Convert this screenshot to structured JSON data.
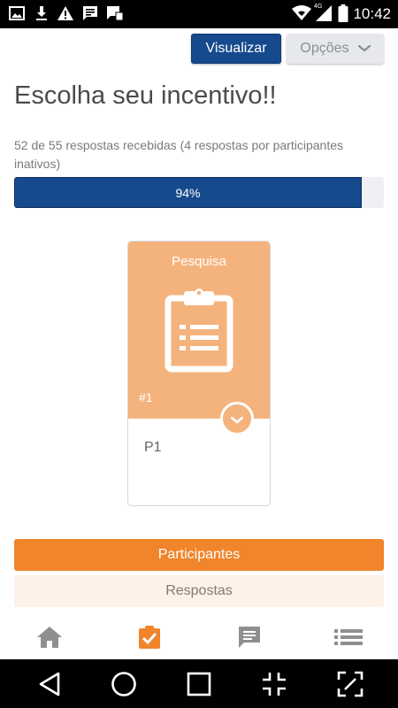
{
  "status_bar": {
    "time": "10:42",
    "network_label": "4G",
    "icons": [
      "image-icon",
      "download-icon",
      "warning-icon",
      "message-icon",
      "sms-icon",
      "wifi-icon",
      "signal-icon",
      "battery-icon"
    ]
  },
  "toolbar": {
    "view_label": "Visualizar",
    "options_label": "Opções"
  },
  "page": {
    "title": "Escolha seu incentivo!!",
    "responses_text": "52 de 55 respostas recebidas (4 respostas por participantes inativos)",
    "progress_label": "94%",
    "progress_value": 0.94
  },
  "card": {
    "type_label": "Pesquisa",
    "number": "#1",
    "name": "P1",
    "icon": "clipboard-list-icon"
  },
  "tabs": {
    "participants_label": "Participantes",
    "responses_label": "Respostas"
  },
  "bottom_nav": {
    "items": [
      "home-icon",
      "tasks-icon",
      "chat-icon",
      "list-icon"
    ],
    "active": "tasks-icon"
  },
  "colors": {
    "primary_blue": "#164a8d",
    "accent_orange": "#f0852b",
    "card_orange": "#f4b37d",
    "nav_gray": "#8f8f8f"
  },
  "android_nav": {
    "buttons": [
      "back-icon",
      "home-circle-icon",
      "recents-icon",
      "collapse-icon",
      "expand-icon"
    ]
  }
}
